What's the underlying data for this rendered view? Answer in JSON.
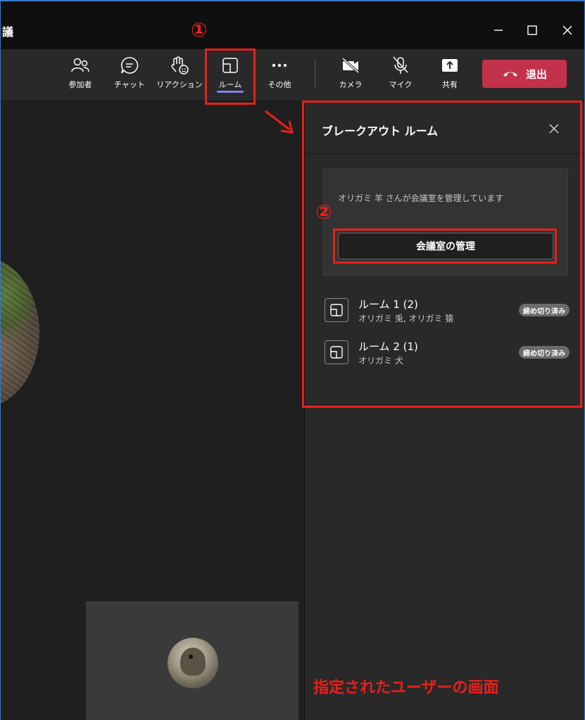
{
  "window": {
    "title": "議",
    "minimize_icon": "minimize-icon",
    "maximize_icon": "maximize-icon",
    "close_icon": "close-icon"
  },
  "toolbar": {
    "items": [
      {
        "label": "参加者",
        "icon": "people-icon"
      },
      {
        "label": "チャット",
        "icon": "chat-icon"
      },
      {
        "label": "リアクション",
        "icon": "reaction-hand-icon"
      },
      {
        "label": "ルーム",
        "icon": "breakout-room-icon",
        "active": true
      },
      {
        "label": "その他",
        "icon": "more-icon"
      },
      {
        "label": "カメラ",
        "icon": "camera-off-icon"
      },
      {
        "label": "マイク",
        "icon": "mic-off-icon"
      },
      {
        "label": "共有",
        "icon": "share-icon"
      }
    ],
    "leave_label": "退出",
    "leave_color": "#c4314b",
    "active_underline_color": "#7f85f5"
  },
  "panel": {
    "title": "ブレークアウト ルーム",
    "manager_text": "オリガミ 羊 さんが会議室を管理しています",
    "manage_button": "会議室の管理",
    "rooms": [
      {
        "name": "ルーム 1 (2)",
        "members": "オリガミ 兎, オリガミ 猿",
        "status": "締め切り済み"
      },
      {
        "name": "ルーム 2 (1)",
        "members": "オリガミ 犬",
        "status": "締め切り済み"
      }
    ]
  },
  "annotations": {
    "step1": "①",
    "step2": "②",
    "caption": "指定されたユーザーの画面",
    "color": "#e8201a"
  }
}
